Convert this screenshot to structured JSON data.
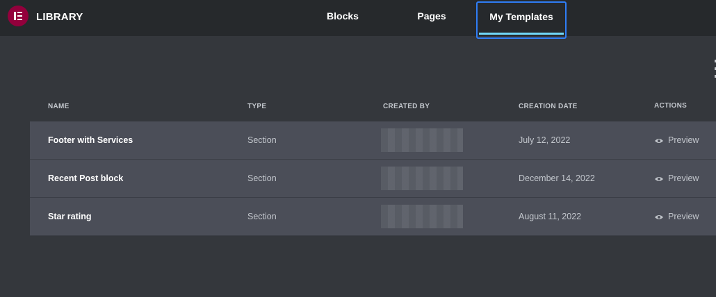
{
  "header": {
    "brand": "LIBRARY",
    "tabs": [
      "Blocks",
      "Pages",
      "My Templates"
    ],
    "active_tab": "My Templates"
  },
  "table": {
    "columns": [
      "NAME",
      "TYPE",
      "CREATED BY",
      "CREATION DATE",
      "ACTIONS"
    ],
    "rows": [
      {
        "name": "Footer with Services",
        "type": "Section",
        "created_by": "",
        "date": "July 12, 2022",
        "action": "Preview"
      },
      {
        "name": "Recent Post block",
        "type": "Section",
        "created_by": "",
        "date": "December 14, 2022",
        "action": "Preview"
      },
      {
        "name": "Star rating",
        "type": "Section",
        "created_by": "",
        "date": "August 11, 2022",
        "action": "Preview"
      }
    ]
  },
  "colors": {
    "topbar": "#26292c",
    "background": "#34373c",
    "row": "#4b4e58",
    "logo": "#93003c",
    "focus_ring": "#2f7df6",
    "tab_underline": "#71d7f7"
  }
}
